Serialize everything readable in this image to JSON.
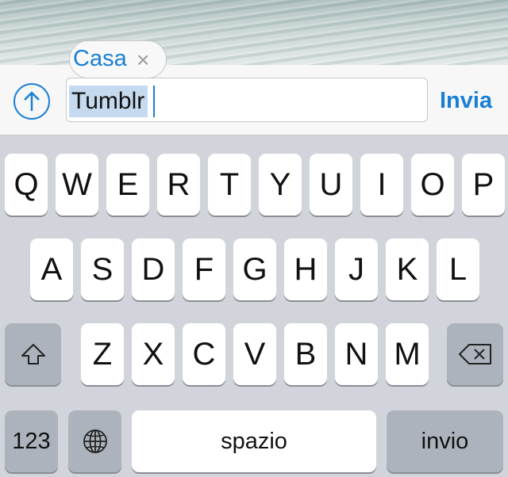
{
  "tag": {
    "label": "Casa",
    "remove_symbol": "×"
  },
  "input": {
    "value": "Tumblr",
    "send_label": "Invia",
    "post_icon": "upload-arrow-icon"
  },
  "keyboard": {
    "row1": [
      "Q",
      "W",
      "E",
      "R",
      "T",
      "Y",
      "U",
      "I",
      "O",
      "P"
    ],
    "row2": [
      "A",
      "S",
      "D",
      "F",
      "G",
      "H",
      "J",
      "K",
      "L"
    ],
    "row3": [
      "Z",
      "X",
      "C",
      "V",
      "B",
      "N",
      "M"
    ],
    "shift_icon": "shift-icon",
    "delete_icon": "backspace-icon",
    "numbers_label": "123",
    "globe_icon": "globe-icon",
    "space_label": "spazio",
    "return_label": "invio"
  },
  "colors": {
    "accent": "#1a7fd4",
    "keyboard_bg": "#d1d5db",
    "dark_key": "#acb3bc",
    "selection": "#c5d9ef"
  }
}
